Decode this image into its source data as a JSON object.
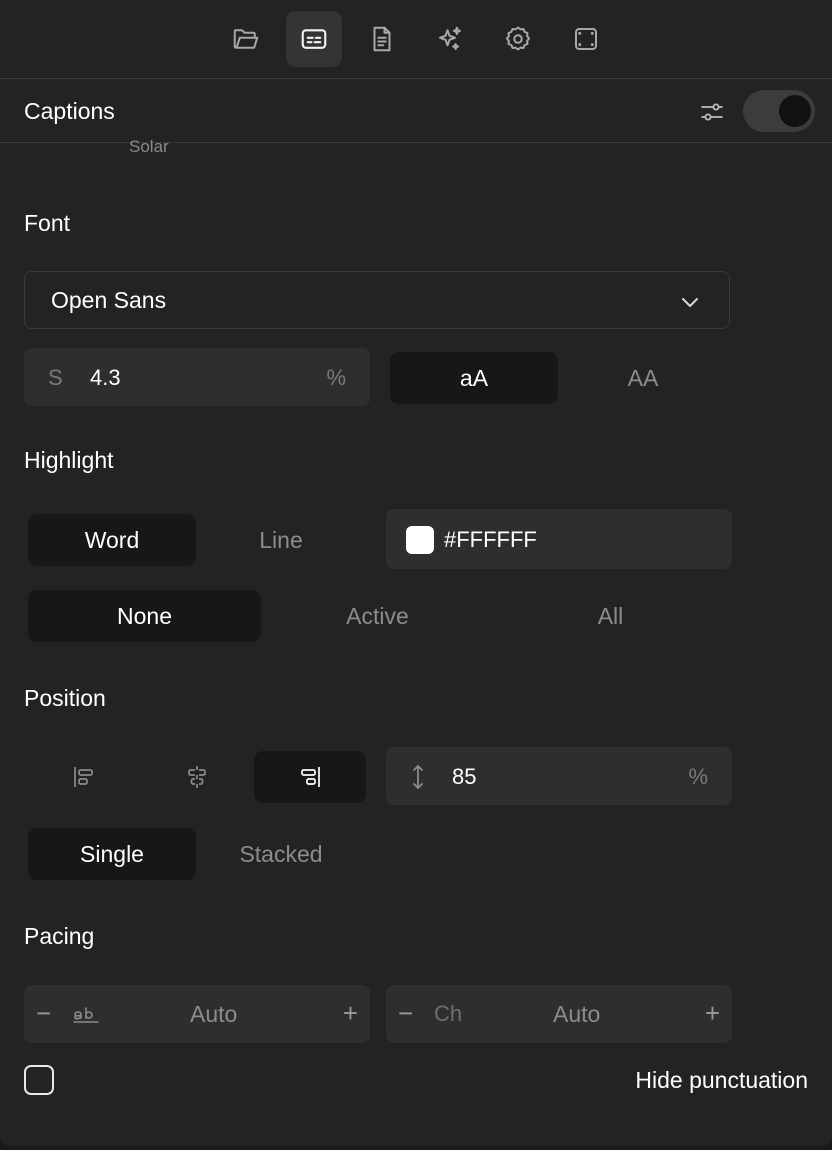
{
  "toolbar": {
    "icons": [
      "folder-icon",
      "captions-icon",
      "document-icon",
      "sparkles-icon",
      "gear-icon",
      "frame-icon"
    ],
    "active": "captions-icon"
  },
  "header": {
    "title": "Captions",
    "toggle_on": true
  },
  "clipped_label": "Solar",
  "font": {
    "label": "Font",
    "family": "Open Sans",
    "size_prefix": "S",
    "size_value": "4.3",
    "size_unit": "%",
    "case_options": [
      "aA",
      "AA"
    ],
    "case_selected": "aA"
  },
  "highlight": {
    "label": "Highlight",
    "mode_options": [
      "Word",
      "Line"
    ],
    "mode_selected": "Word",
    "color": "#FFFFFF",
    "scope_options": [
      "None",
      "Active",
      "All"
    ],
    "scope_selected": "None"
  },
  "position": {
    "label": "Position",
    "align_options": [
      "align-left-icon",
      "align-center-icon",
      "align-right-icon"
    ],
    "align_selected": "align-right-icon",
    "vertical_value": "85",
    "vertical_unit": "%",
    "layout_options": [
      "Single",
      "Stacked"
    ],
    "layout_selected": "Single"
  },
  "pacing": {
    "label": "Pacing",
    "words": {
      "minus": "−",
      "unit_icon": "words-icon",
      "value": "Auto",
      "plus": "+"
    },
    "chars": {
      "minus": "−",
      "unit": "Ch",
      "value": "Auto",
      "plus": "+"
    }
  },
  "hide_punctuation": {
    "label": "Hide punctuation",
    "checked": false
  },
  "colors": {
    "panel": "#232323",
    "field": "#2e2e2e",
    "selected": "#171717",
    "divider": "#3a3a3a"
  }
}
